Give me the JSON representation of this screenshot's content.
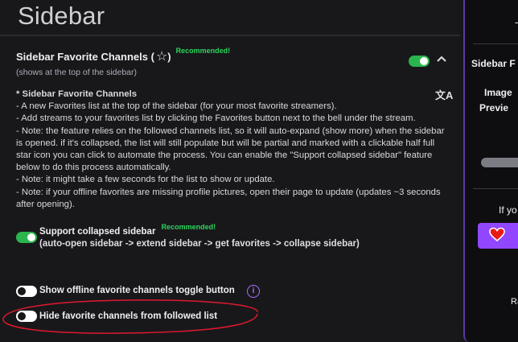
{
  "page": {
    "title": "Sidebar"
  },
  "favorite_channels": {
    "title": "Sidebar Favorite Channels (",
    "title_close": ")",
    "recommended": "Recommended!",
    "subtitle": "(shows at the top of the sidebar)",
    "toggle_on": true,
    "expanded": true
  },
  "description": [
    "* Sidebar Favorite Channels",
    "- A new Favorites list at the top of the sidebar (for your most favorite streamers).",
    "- Add streams to your favorites list by clicking the Favorites button next to the bell under the stream.",
    "- Note: the feature relies on the followed channels list, so it will auto-expand (show more) when the sidebar is opened. if it's collapsed, the list will still populate but will be partial and marked with a clickable half full star icon you can click to automate the process. You can enable the \"Support collapsed sidebar\" feature below to do this process automatically.",
    "- Note: it might take a few seconds for the list to show or update.",
    "- Note: if your offline favorites are missing profile pictures, open their page to update (updates ~3 seconds after opening)."
  ],
  "options": {
    "support_collapsed": {
      "label": "Support collapsed sidebar",
      "recommended": "Recommended!",
      "sub": "(auto-open sidebar -> extend sidebar -> get favorites -> collapse sidebar)",
      "on": true
    },
    "show_offline": {
      "label": "Show offline favorite channels toggle button",
      "on": false
    },
    "hide_favorites": {
      "label": "Hide favorite channels from followed list",
      "on": false
    }
  },
  "right_panel": {
    "dash": "-",
    "heading": "Sidebar F",
    "image_label": "Image",
    "preview_label": "Previe",
    "if_text": "If yo",
    "bottom_text": "Ra"
  },
  "colors": {
    "accent": "#9147ff",
    "toggle_on": "#2bb54e",
    "recommended": "#2bd65a",
    "annotation": "#e0182d"
  },
  "icons": {
    "star": "star-outline-icon",
    "chevron": "chevron-up-icon",
    "translate": "translate-icon",
    "info": "info-icon",
    "heart": "heart-icon"
  }
}
